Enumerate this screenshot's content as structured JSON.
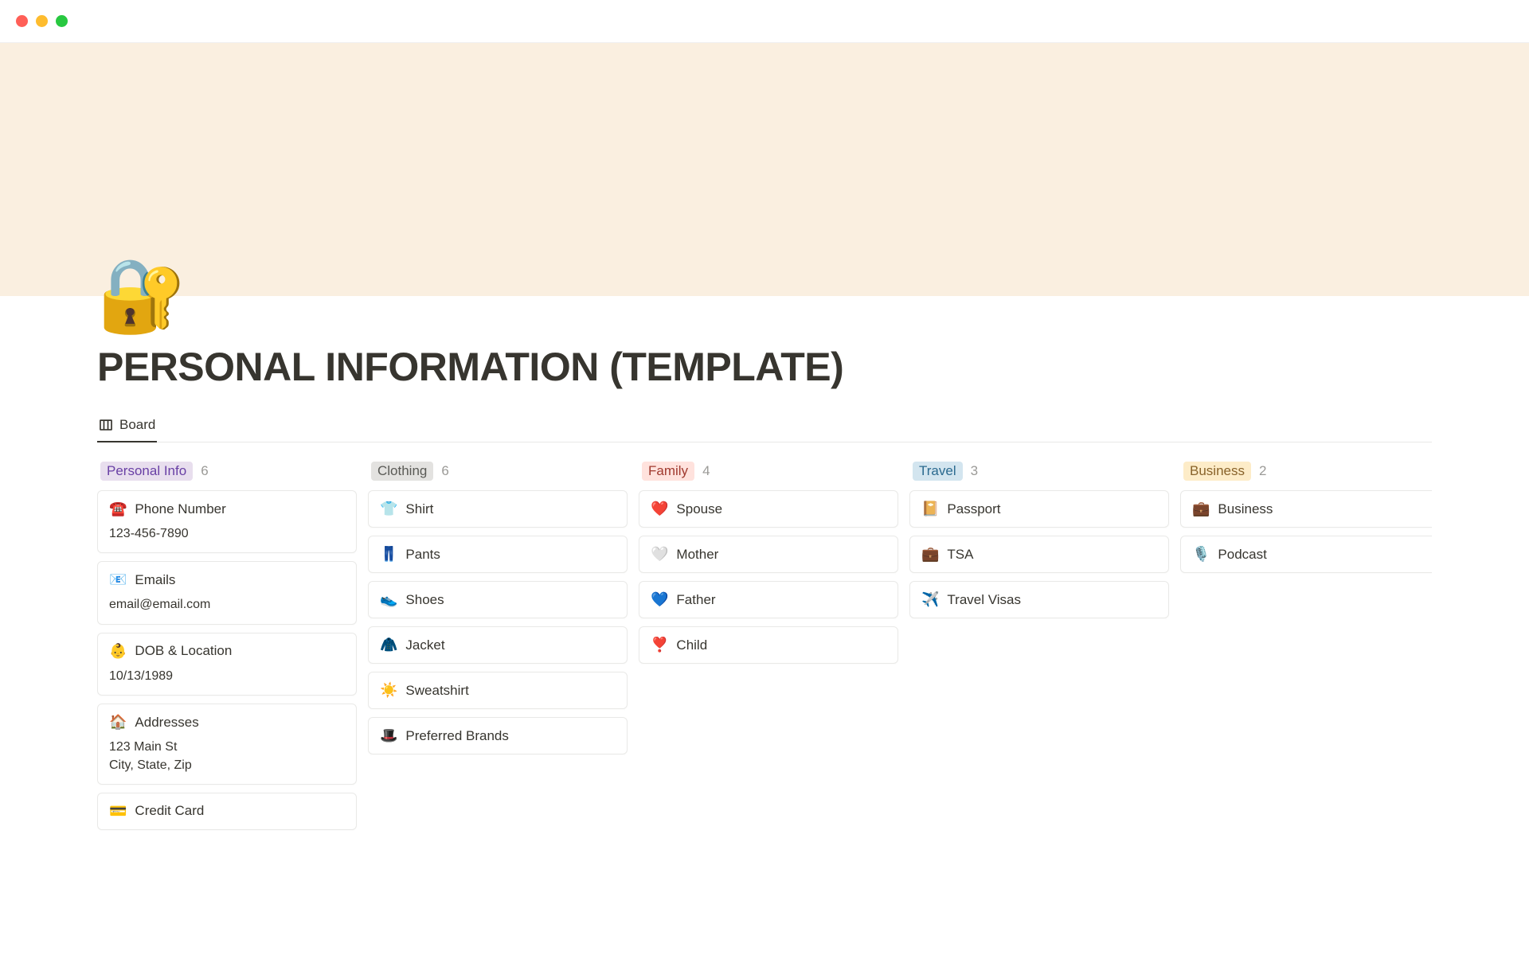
{
  "page": {
    "icon": "🔐",
    "title": "PERSONAL INFORMATION (TEMPLATE)"
  },
  "tabs": {
    "board": "Board"
  },
  "columns": [
    {
      "tag": "Personal Info",
      "tagClass": "tag-personal",
      "count": "6",
      "cards": [
        {
          "emoji": "☎️",
          "title": "Phone Number",
          "body": "123-456-7890"
        },
        {
          "emoji": "📧",
          "title": "Emails",
          "body": "email@email.com"
        },
        {
          "emoji": "👶",
          "title": "DOB & Location",
          "body": "10/13/1989"
        },
        {
          "emoji": "🏠",
          "title": "Addresses",
          "body": "123 Main St\nCity, State, Zip"
        },
        {
          "emoji": "💳",
          "title": "Credit Card"
        }
      ]
    },
    {
      "tag": "Clothing",
      "tagClass": "tag-clothing",
      "count": "6",
      "cards": [
        {
          "emoji": "👕",
          "title": "Shirt"
        },
        {
          "emoji": "👖",
          "title": "Pants"
        },
        {
          "emoji": "👟",
          "title": "Shoes"
        },
        {
          "emoji": "🧥",
          "title": "Jacket"
        },
        {
          "emoji": "☀️",
          "title": "Sweatshirt"
        },
        {
          "emoji": "🎩",
          "title": "Preferred Brands"
        }
      ]
    },
    {
      "tag": "Family",
      "tagClass": "tag-family",
      "count": "4",
      "cards": [
        {
          "emoji": "❤️",
          "title": "Spouse"
        },
        {
          "emoji": "🤍",
          "title": "Mother"
        },
        {
          "emoji": "💙",
          "title": "Father"
        },
        {
          "emoji": "❣️",
          "title": "Child"
        }
      ]
    },
    {
      "tag": "Travel",
      "tagClass": "tag-travel",
      "count": "3",
      "cards": [
        {
          "emoji": "📔",
          "title": "Passport"
        },
        {
          "emoji": "💼",
          "title": "TSA"
        },
        {
          "emoji": "✈️",
          "title": "Travel Visas"
        }
      ]
    },
    {
      "tag": "Business",
      "tagClass": "tag-business",
      "count": "2",
      "cards": [
        {
          "emoji": "💼",
          "title": "Business"
        },
        {
          "emoji": "🎙️",
          "title": "Podcast"
        }
      ]
    }
  ]
}
